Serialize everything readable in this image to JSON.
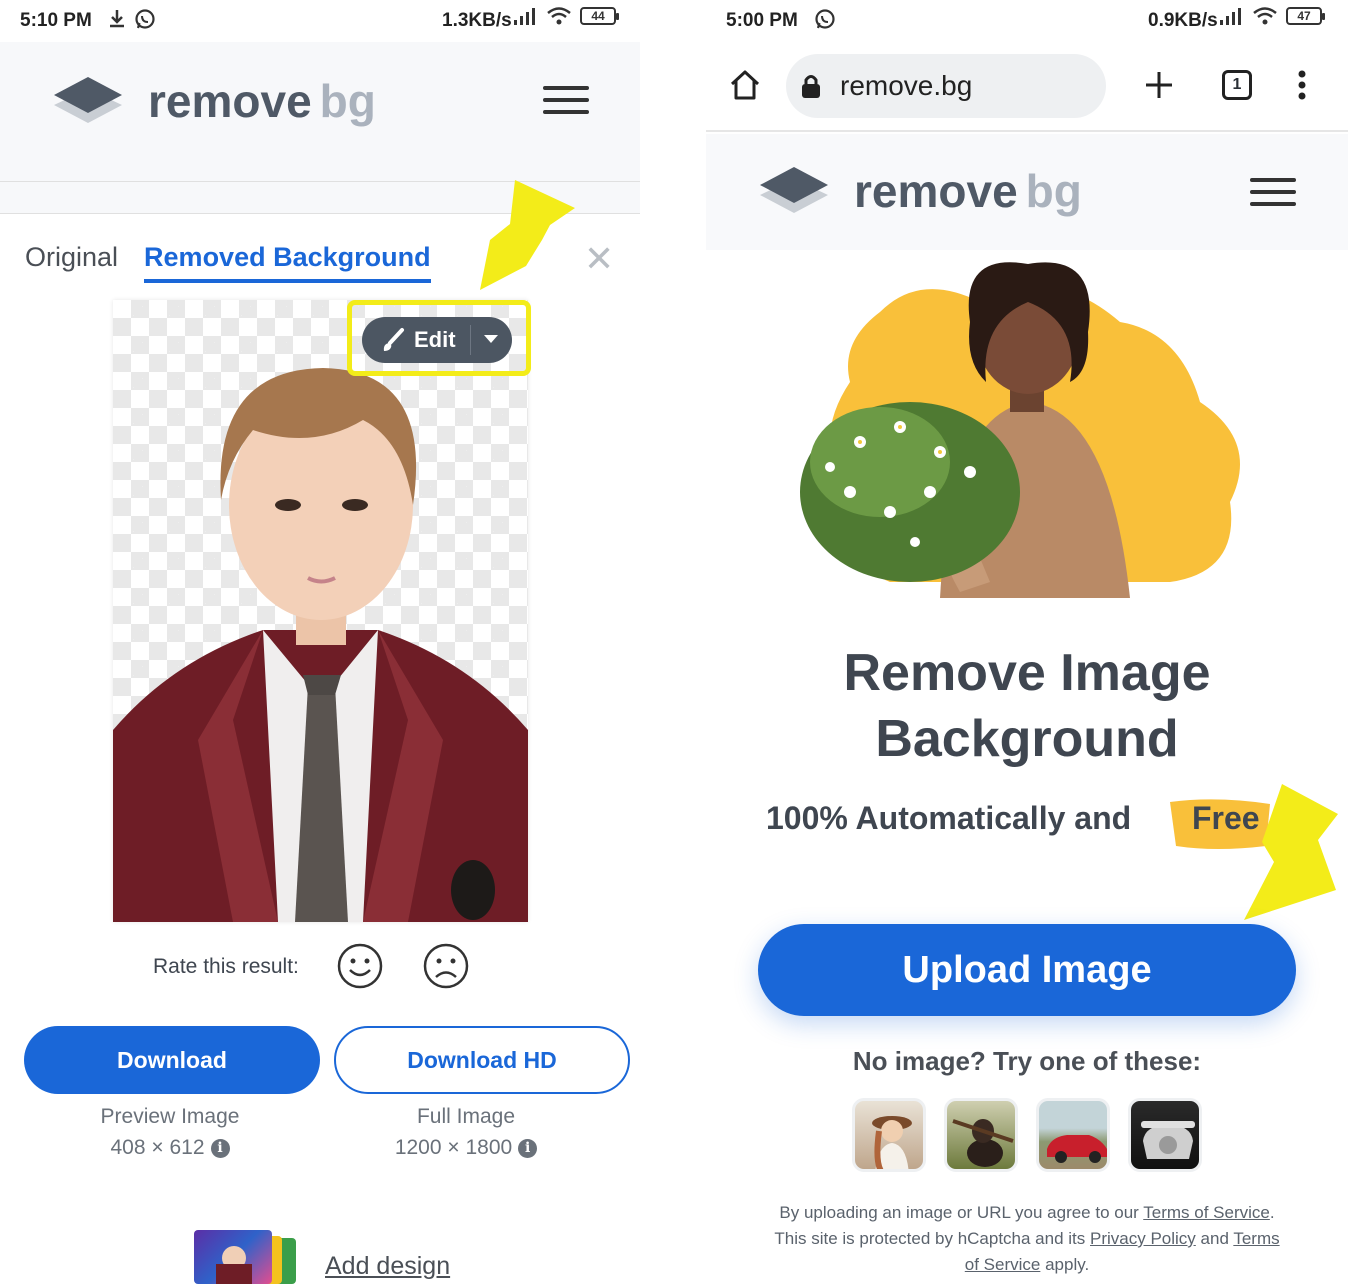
{
  "left_screen": {
    "status": {
      "time": "5:10 PM",
      "speed": "1.3KB/s",
      "battery": "44"
    },
    "logo": {
      "remove": "remove",
      "bg": "bg"
    },
    "tabs": {
      "original": "Original",
      "removed": "Removed Background"
    },
    "edit_button": {
      "label": "Edit"
    },
    "rate_label": "Rate this result:",
    "download": {
      "label": "Download",
      "caption": "Preview Image",
      "dims": "408 × 612"
    },
    "download_hd": {
      "label": "Download HD",
      "caption": "Full Image",
      "dims": "1200 × 1800"
    },
    "add_design": "Add design"
  },
  "right_screen": {
    "status": {
      "time": "5:00 PM",
      "speed": "0.9KB/s",
      "battery": "47"
    },
    "browser": {
      "url": "remove.bg",
      "tab_count": "1"
    },
    "logo": {
      "remove": "remove",
      "bg": "bg"
    },
    "hero": {
      "title_line1": "Remove Image",
      "title_line2": "Background",
      "subtitle": "100% Automatically and",
      "free": "Free"
    },
    "upload_button": "Upload Image",
    "try_label": "No image? Try one of these:",
    "legal": {
      "line1_pre": "By uploading an image or URL you agree to our ",
      "terms": "Terms of Service",
      "line1_post": ".",
      "line2_pre": "This site is protected by hCaptcha and its ",
      "privacy": "Privacy Policy",
      "and": " and ",
      "terms2_a": "Terms",
      "terms2_b": "of Service",
      "apply": " apply."
    }
  },
  "colors": {
    "brand_blue": "#1a67d8",
    "highlight_yellow": "#f3ec19",
    "logo_dark": "#4f5966",
    "logo_light": "#aab2bd",
    "blob_yellow": "#f9c03a"
  },
  "icons": [
    "download-icon",
    "whatsapp-icon",
    "signal-icon",
    "wifi-icon",
    "battery-icon",
    "hamburger-icon",
    "close-icon",
    "brush-icon",
    "caret-down-icon",
    "smile-icon",
    "frown-icon",
    "info-icon",
    "home-icon",
    "lock-icon",
    "plus-icon",
    "tabs-icon",
    "more-icon",
    "arrow-icon"
  ]
}
